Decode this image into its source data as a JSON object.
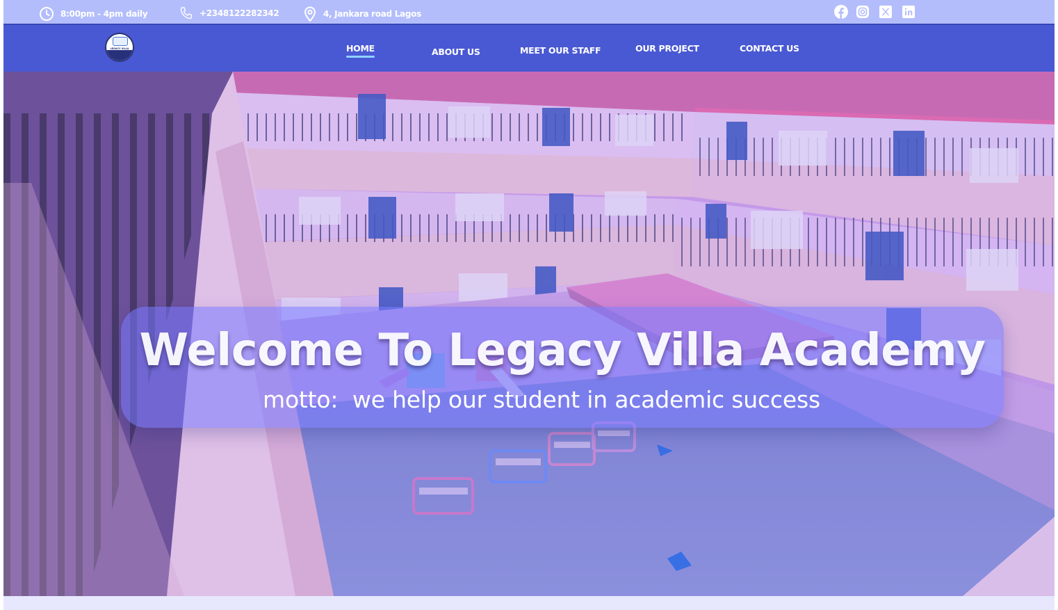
{
  "topbar": {
    "hours": "8:00pm - 4pm daily",
    "phone": "+2348122282342",
    "address": "4, Jankara road Lagos",
    "icons": {
      "hours": "clock-icon",
      "phone": "phone-icon",
      "address": "location-pin-icon"
    },
    "social": [
      "facebook-icon",
      "instagram-icon",
      "x-icon",
      "linkedin-icon"
    ]
  },
  "nav": {
    "logo_text": "LEGACY VILLA SCHOOLS",
    "items": [
      {
        "label": "HOME",
        "active": true
      },
      {
        "label": "ABOUT US",
        "active": false
      },
      {
        "label": "MEET OUR STAFF",
        "active": false
      },
      {
        "label": "OUR PROJECT",
        "active": false
      },
      {
        "label": "CONTACT US",
        "active": false
      }
    ]
  },
  "hero": {
    "headline": "Welcome  To Legacy Villa Academy",
    "motto": "motto:  we help our student in academic success"
  },
  "colors": {
    "topbar": "#b3bdfb",
    "navbar": "#4959d3",
    "banner": "#767aff",
    "active_underline": "#8fd3ff"
  }
}
